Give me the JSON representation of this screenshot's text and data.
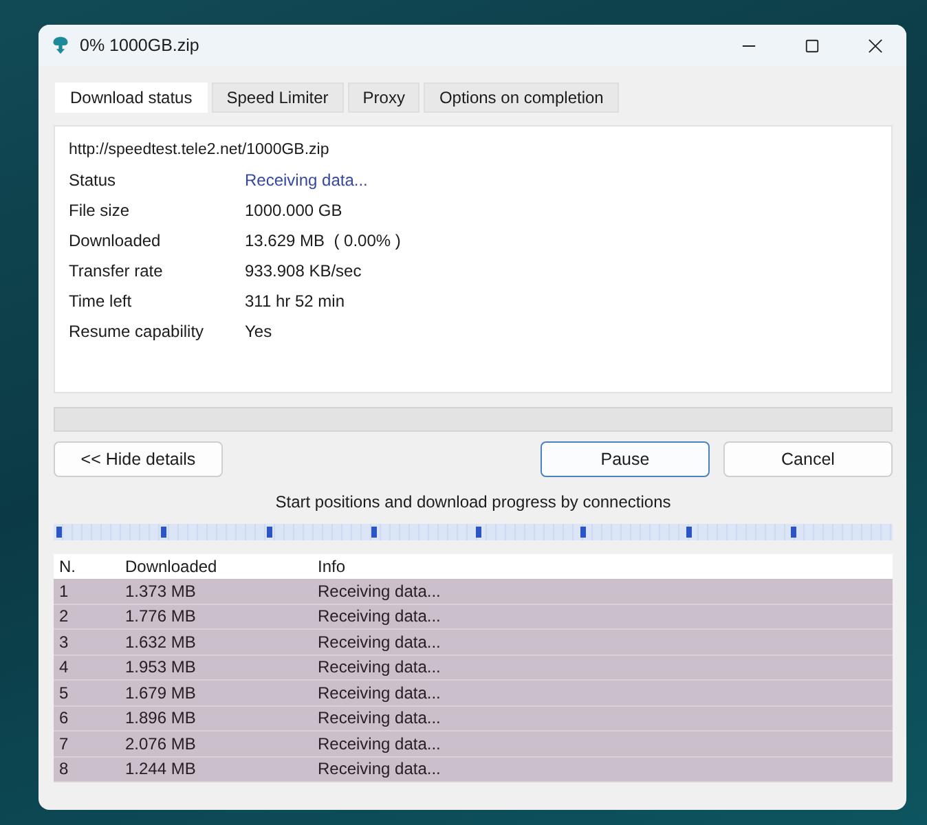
{
  "window": {
    "title": "0% 1000GB.zip"
  },
  "tabs": [
    {
      "label": "Download status",
      "selected": true
    },
    {
      "label": "Speed Limiter",
      "selected": false
    },
    {
      "label": "Proxy",
      "selected": false
    },
    {
      "label": "Options on completion",
      "selected": false
    }
  ],
  "details": {
    "url": "http://speedtest.tele2.net/1000GB.zip",
    "fields": [
      {
        "label": "Status",
        "value": "Receiving data...",
        "kind": "status"
      },
      {
        "label": "File size",
        "value": "1000.000 GB",
        "kind": "text"
      },
      {
        "label": "Downloaded",
        "value": "13.629 MB  ( 0.00% )",
        "kind": "text"
      },
      {
        "label": "Transfer rate",
        "value": "933.908 KB/sec",
        "kind": "text"
      },
      {
        "label": "Time left",
        "value": "311 hr 52 min",
        "kind": "text"
      },
      {
        "label": "Resume capability",
        "value": "Yes",
        "kind": "text"
      }
    ]
  },
  "details_button": {
    "label": "<< Hide details"
  },
  "buttons": [
    {
      "label": "Pause",
      "default": true
    },
    {
      "label": "Cancel",
      "default": false
    }
  ],
  "connections": {
    "caption": "Start positions and download progress by connections",
    "columns": [
      "N.",
      "Downloaded",
      "Info"
    ],
    "rows": [
      {
        "n": "1",
        "downloaded": "1.373 MB",
        "info": "Receiving data..."
      },
      {
        "n": "2",
        "downloaded": "1.776 MB",
        "info": "Receiving data..."
      },
      {
        "n": "3",
        "downloaded": "1.632 MB",
        "info": "Receiving data..."
      },
      {
        "n": "4",
        "downloaded": "1.953 MB",
        "info": "Receiving data..."
      },
      {
        "n": "5",
        "downloaded": "1.679 MB",
        "info": "Receiving data..."
      },
      {
        "n": "6",
        "downloaded": "1.896 MB",
        "info": "Receiving data..."
      },
      {
        "n": "7",
        "downloaded": "2.076 MB",
        "info": "Receiving data..."
      },
      {
        "n": "8",
        "downloaded": "1.244 MB",
        "info": "Receiving data..."
      }
    ]
  }
}
